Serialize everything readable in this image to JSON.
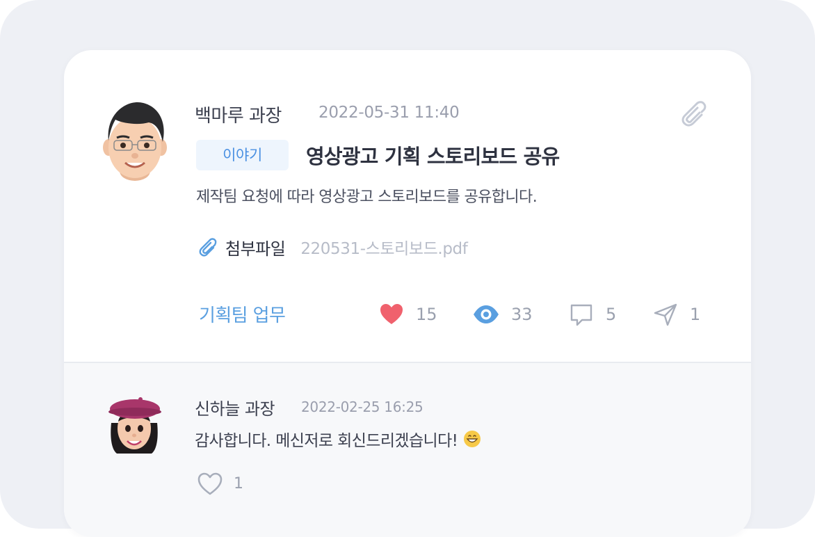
{
  "post": {
    "author": "백마루 과장",
    "date": "2022-05-31 11:40",
    "category": "이야기",
    "title": "영상광고 기획 스토리보드 공유",
    "body": "제작팀 요청에 따라 영상광고 스토리보드를 공유합니다.",
    "attachment_label": "첨부파일",
    "attachment_file": "220531-스토리보드.pdf",
    "team": "기획팀 업무",
    "stats": {
      "likes": "15",
      "views": "33",
      "comments": "5",
      "shares": "1"
    }
  },
  "comment": {
    "author": "신하늘 과장",
    "date": "2022-02-25 16:25",
    "text": "감사합니다. 메신저로 회신드리겠습니다!",
    "likes": "1"
  },
  "colors": {
    "accent": "#4a90e2",
    "heart": "#f0616d",
    "eye": "#5a9fe0",
    "muted": "#9aa0ae"
  },
  "icons": [
    "paperclip-icon",
    "heart-icon",
    "eye-icon",
    "comment-icon",
    "send-icon",
    "heart-outline-icon",
    "grinning-emoji-icon"
  ]
}
